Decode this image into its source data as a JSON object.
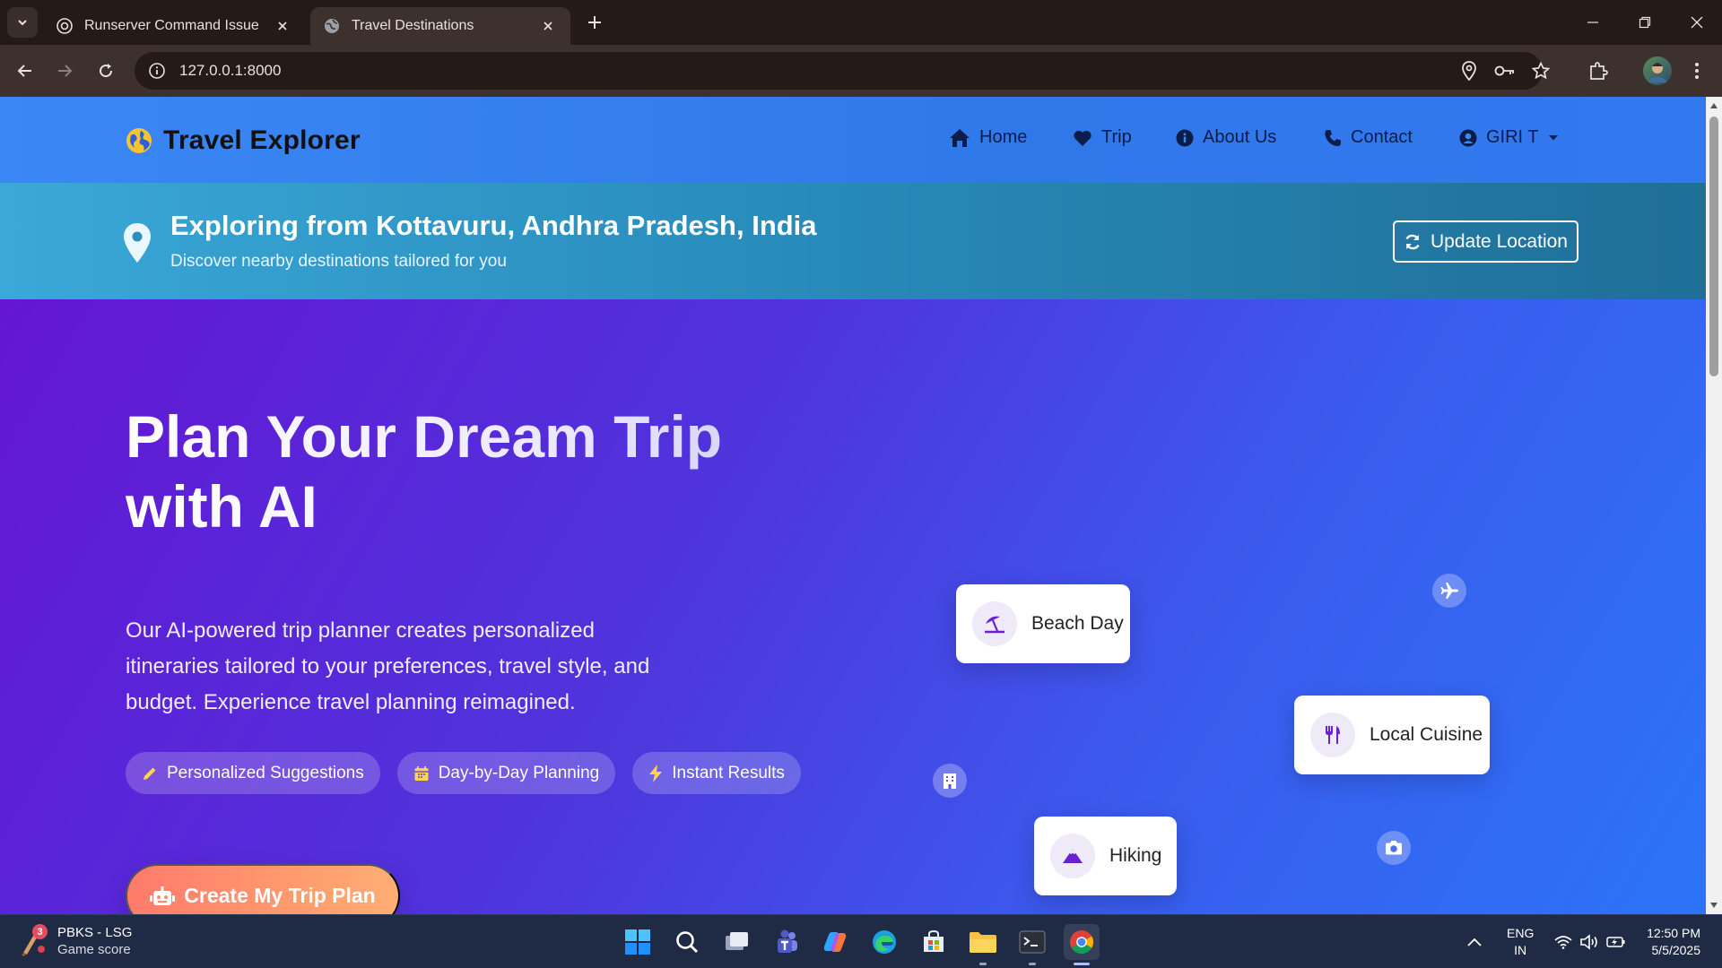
{
  "browser": {
    "tabs": [
      {
        "title": "Runserver Command Issue",
        "active": false
      },
      {
        "title": "Travel Destinations",
        "active": true
      }
    ],
    "url": "127.0.0.1:8000"
  },
  "site": {
    "brand": "Travel Explorer",
    "nav": [
      {
        "label": "Home",
        "icon": "home-icon"
      },
      {
        "label": "Trip",
        "icon": "heart-icon"
      },
      {
        "label": "About Us",
        "icon": "info-icon"
      },
      {
        "label": "Contact",
        "icon": "phone-icon"
      },
      {
        "label": "GIRI T",
        "icon": "user-circle-icon"
      }
    ],
    "location": {
      "title": "Exploring from Kottavuru, Andhra Pradesh, India",
      "subtitle": "Discover nearby destinations tailored for you",
      "update_button": "Update Location"
    },
    "hero": {
      "title": "Plan Your Dream Trip with AI",
      "description": "Our AI-powered trip planner creates personalized itineraries tailored to your preferences, travel style, and budget. Experience travel planning reimagined.",
      "chips": [
        "Personalized Suggestions",
        "Day-by-Day Planning",
        "Instant Results"
      ],
      "cta": "Create My Trip Plan",
      "cards": [
        "Beach Day",
        "Local Cuisine",
        "Hiking"
      ]
    }
  },
  "taskbar": {
    "widget": {
      "title": "PBKS - LSG",
      "subtitle": "Game score",
      "badge": "3"
    },
    "language": [
      "ENG",
      "IN"
    ],
    "time": "12:50 PM",
    "date": "5/5/2025"
  },
  "colors": {
    "nav_bg": "#3b87f5",
    "banner_bg": "#2789b8",
    "hero_start": "#6416d4",
    "hero_end": "#2b74f7",
    "cta": "#ff8a6d"
  }
}
